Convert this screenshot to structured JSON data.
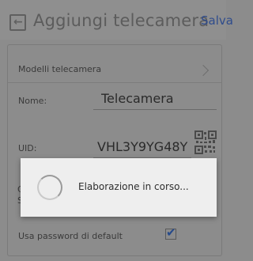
{
  "header": {
    "title": "Aggiungi telecamera",
    "save_label": "Salva"
  },
  "form": {
    "camera_models_label": "Modelli telecamera",
    "name_label": "Nome:",
    "name_value": "Telecamera",
    "uid_label": "UID:",
    "uid_value": "VHL3Y9YG48Y",
    "default_password_label": "Usa password di default",
    "default_password_checked": true,
    "partial_label_1": "C",
    "partial_label_2": "S"
  },
  "dialog": {
    "message": "Elaborazione in corso..."
  },
  "icons": {
    "back": "back-arrow-icon",
    "chevron": "chevron-right-icon",
    "qr": "qr-code-icon",
    "spinner": "loading-spinner-icon",
    "check": "checkmark-icon"
  },
  "colors": {
    "overlay": "#8c8c8c",
    "save_accent": "#2f4c8c",
    "dialog_bg": "#eeeeee"
  }
}
